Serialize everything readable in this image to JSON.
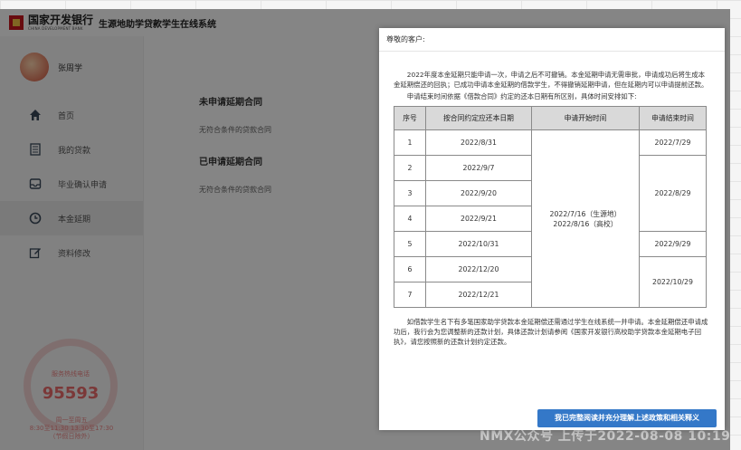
{
  "header": {
    "logo_cn": "国家开发银行",
    "logo_en": "CHINA DEVELOPMENT BANK",
    "system_title": "生源地助学贷款学生在线系统"
  },
  "sidebar": {
    "user_name": "张周学",
    "items": [
      {
        "label": "首页",
        "icon": "home-icon"
      },
      {
        "label": "我的贷款",
        "icon": "document-list-icon"
      },
      {
        "label": "毕业确认申请",
        "icon": "inbox-icon"
      },
      {
        "label": "本金延期",
        "icon": "clock-icon"
      },
      {
        "label": "资料修改",
        "icon": "edit-icon"
      }
    ],
    "active_index": 3,
    "hotline_label": "服务热线电话",
    "hotline_number": "95593",
    "hours_line1": "周一至周五",
    "hours_line2": "8:30至11:30 13:30至17:30",
    "hours_line3": "（节假日除外）"
  },
  "main": {
    "section1_title": "未申请延期合同",
    "section1_sub": "无符合条件的贷款合同",
    "section2_title": "已申请延期合同",
    "section2_sub": "无符合条件的贷款合同"
  },
  "modal": {
    "greeting": "尊敬的客户:",
    "para1": "2022年度本金延期只能申请一次，申请之后不可撤销。本金延期申请无需审批，申请成功后将生成本金延期偿还的回执；已成功申请本金延期的借款学生，不得撤销延期申请，但在延期内可以申请提前还款。",
    "table_intro": "申请结束时间依据《借款合同》约定的还本日期有所区别，具体时间安排如下:",
    "columns": [
      "序号",
      "按合同约定应还本日期",
      "申请开始时间",
      "申请结束时间"
    ],
    "rows": [
      {
        "no": "1",
        "due": "2022/8/31"
      },
      {
        "no": "2",
        "due": "2022/9/7"
      },
      {
        "no": "3",
        "due": "2022/9/20"
      },
      {
        "no": "4",
        "due": "2022/9/21"
      },
      {
        "no": "5",
        "due": "2022/10/31"
      },
      {
        "no": "6",
        "due": "2022/12/20"
      },
      {
        "no": "7",
        "due": "2022/12/21"
      }
    ],
    "start_line1": "2022/7/16（生源地）",
    "start_line2": "2022/8/16（高校）",
    "end_dates": [
      "2022/7/29",
      "2022/8/29",
      "2022/9/29",
      "2022/10/29"
    ],
    "para2": "如借款学生名下有多笔国家助学贷款本金延期偿还需通过学生在线系统一并申请。本金延期偿还申请成功后，我行会为您调整新的还款计划，具体还款计划请参阅《国家开发银行高校助学贷款本金延期电子回执》，请您按照新的还款计划约定还款。",
    "confirm_label": "我已完整阅读并充分理解上述政策和相关释义"
  },
  "watermark": "NMX公众号 上传于2022-08-08 10:19"
}
